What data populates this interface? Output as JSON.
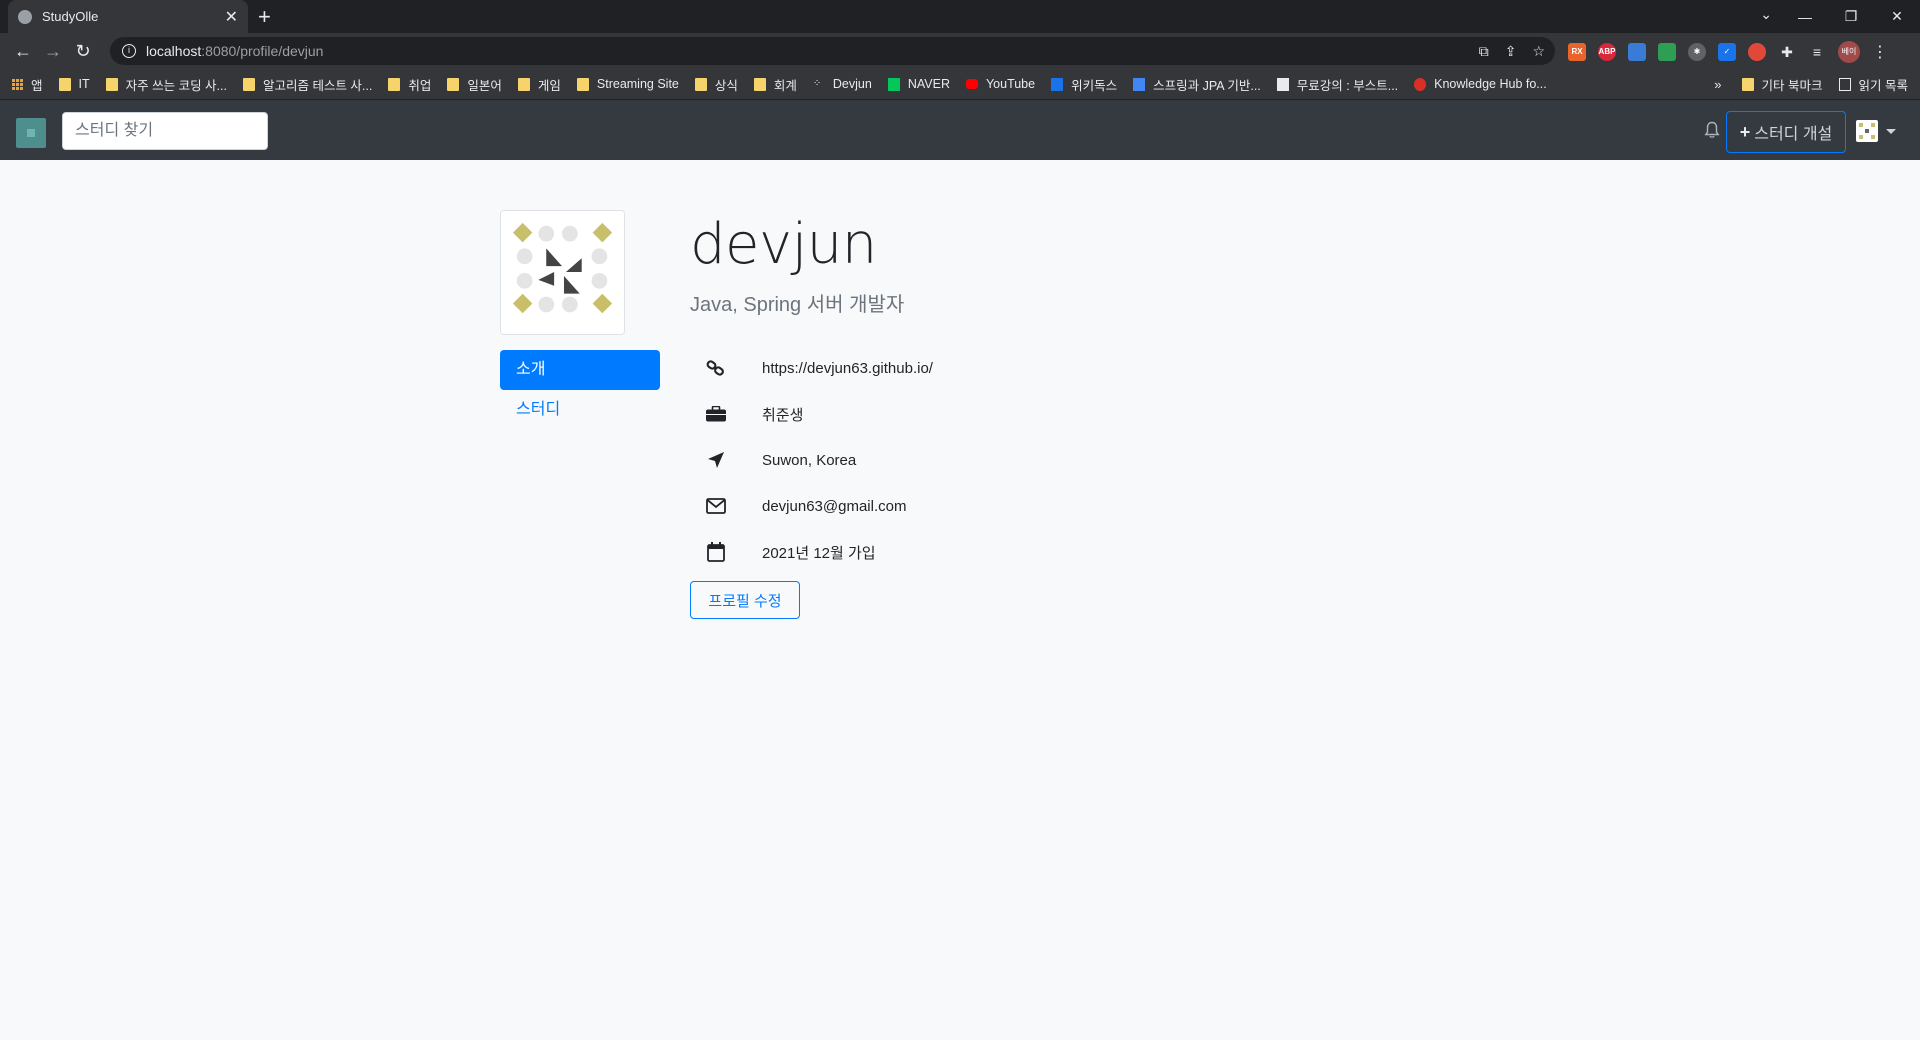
{
  "browser": {
    "tab_title": "StudyOlle",
    "url_host": "localhost",
    "url_path": ":8080/profile/devjun",
    "bookmarks": [
      "앱",
      "IT",
      "자주 쓰는 코딩 사...",
      "알고리즘 테스트 사...",
      "취업",
      "일본어",
      "게임",
      "Streaming Site",
      "상식",
      "회계",
      "Devjun",
      "NAVER",
      "YouTube",
      "위키독스",
      "스프링과 JPA 기반...",
      "무료강의 : 부스트...",
      "Knowledge Hub fo..."
    ],
    "bookmarks_overflow": "»",
    "bookmarks_right": [
      "기타 북마크",
      "읽기 목록"
    ],
    "profile_chip": "베이"
  },
  "navbar": {
    "search_placeholder": "스터디 찾기",
    "new_study_label": "스터디 개설",
    "new_study_plus": "+"
  },
  "profile": {
    "name": "devjun",
    "bio": "Java, Spring 서버 개발자",
    "tabs": [
      "소개",
      "스터디"
    ],
    "active_tab": "소개",
    "url": "https://devjun63.github.io/",
    "occupation": "취준생",
    "location": "Suwon, Korea",
    "email": "devjun63@gmail.com",
    "joined": "2021년 12월 가입",
    "edit_label": "프로필 수정"
  },
  "colors": {
    "primary": "#007bff",
    "navbar": "#343a40",
    "avatar_accent": "#c8bf6a"
  }
}
